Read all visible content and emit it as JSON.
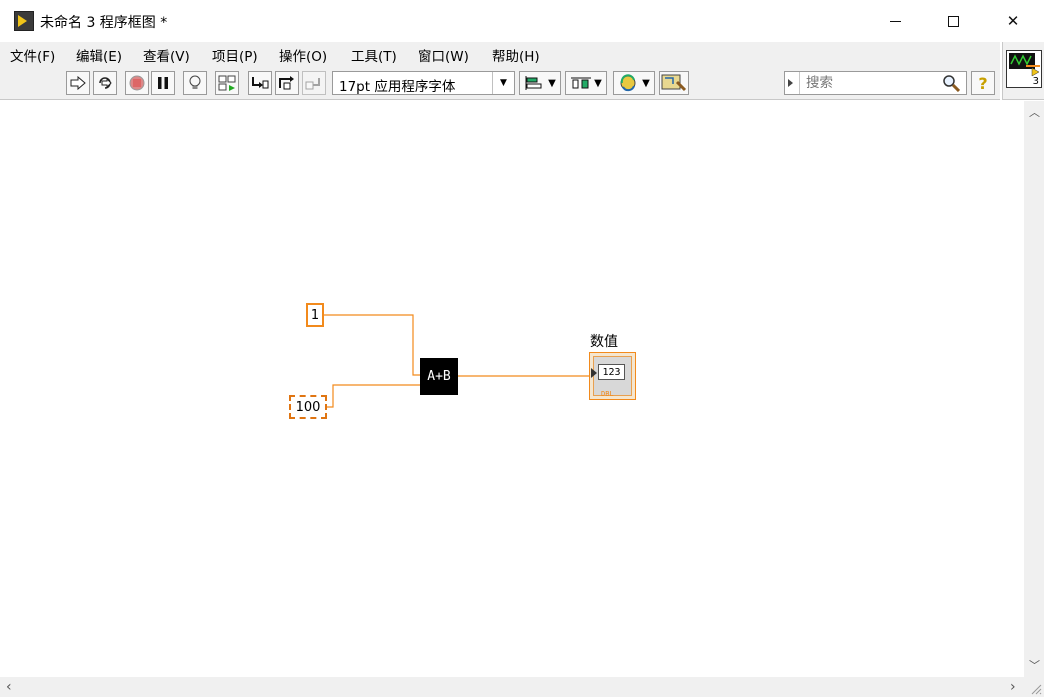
{
  "window": {
    "title": "未命名 3 程序框图 *",
    "controls": {
      "minimize": "—",
      "maximize": "☐",
      "close": "✕"
    }
  },
  "menu": [
    "文件(F)",
    "编辑(E)",
    "查看(V)",
    "项目(P)",
    "操作(O)",
    "工具(T)",
    "窗口(W)",
    "帮助(H)"
  ],
  "toolbar": {
    "font_select": "17pt 应用程序字体",
    "search_placeholder": "搜索",
    "help_label": "?",
    "icons": [
      "run-arrow-icon",
      "run-continuous-icon",
      "abort-icon",
      "pause-icon",
      "highlight-execution-icon",
      "retain-wire-values-icon",
      "step-into-icon",
      "step-over-icon",
      "step-out-icon",
      "align-objects-icon",
      "distribute-objects-icon",
      "reorder-icon",
      "clean-up-diagram-icon"
    ]
  },
  "vi_icon": {
    "number": "3"
  },
  "diagram": {
    "constant_a": "1",
    "constant_b": "100",
    "add_function": "A+B",
    "indicator_label": "数值",
    "indicator_value": "123",
    "indicator_type": "DBL",
    "wire_color": "#f28a1c"
  },
  "colors": {
    "numeric_orange": "#f28a1c",
    "menu_bg": "#f0f0f0",
    "canvas_bg": "#ffffff"
  }
}
